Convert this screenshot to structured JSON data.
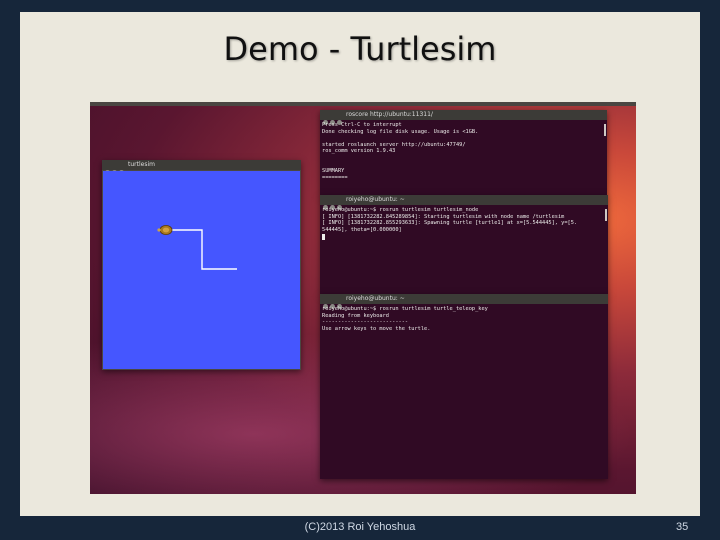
{
  "slide": {
    "title": "Demo - Turtlesim",
    "footer": "(C)2013 Roi Yehoshua",
    "page_number": "35"
  },
  "turtlesim": {
    "title": "turtlesim",
    "background_color": "#4556ff",
    "path_color": "#ffffff"
  },
  "terminals": [
    {
      "title": "roscore http://ubuntu:11311/",
      "lines": [
        "Press Ctrl-C to interrupt",
        "Done checking log file disk usage. Usage is <1GB.",
        "",
        "started roslaunch server http://ubuntu:47749/",
        "ros_comm version 1.9.43",
        "",
        "",
        "SUMMARY",
        "========"
      ]
    },
    {
      "title": "roiyeho@ubuntu: ~",
      "lines": [
        "roiyeho@ubuntu:~$ rosrun turtlesim turtlesim_node",
        "[ INFO] [1381732282.845289854]: Starting turtlesim with node name /turtlesim",
        "[ INFO] [1381732282.855293633]: Spawning turtle [turtle1] at x=[5.544445], y=[5.",
        "544445], theta=[0.000000]"
      ]
    },
    {
      "title": "roiyeho@ubuntu: ~",
      "lines": [
        "roiyeho@ubuntu:~$ rosrun turtlesim turtle_teleop_key",
        "Reading from keyboard",
        "---------------------------",
        "Use arrow keys to move the turtle."
      ]
    }
  ]
}
